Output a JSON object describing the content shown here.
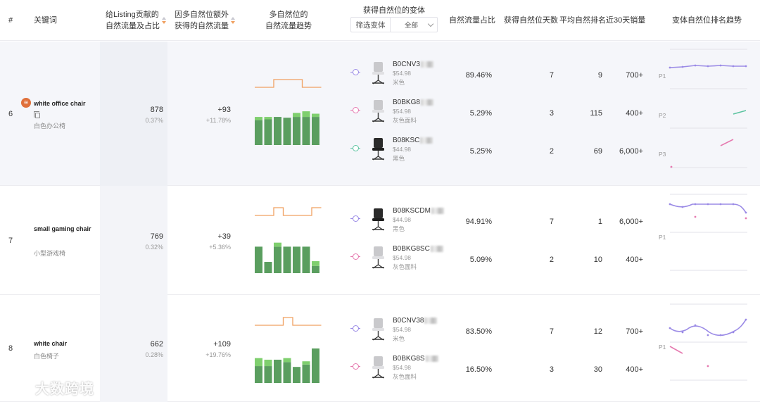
{
  "header": {
    "index": "#",
    "keyword": "关键词",
    "traffic_line1": "给Listing贡献的",
    "traffic_line2": "自然流量及占比",
    "extra_line1": "因多自然位额外",
    "extra_line2": "获得的自然流量",
    "trend_line1": "多自然位的",
    "trend_line2": "自然流量趋势",
    "variants": "获得自然位的变体",
    "filter_label": "筛选变体",
    "filter_value": "全部",
    "share": "自然流量占比",
    "days": "获得自然位天数",
    "avg_rank": "平均自然排名",
    "sales30": "近30天销量",
    "rank_trend": "变体自然位排名趋势"
  },
  "colors": {
    "bar_dark": "#5a9e5f",
    "bar_light": "#7fcf6e",
    "step_line": "#f0a060",
    "purple": "#9b8be6",
    "pink": "#e67ab0",
    "teal": "#5cc4a0"
  },
  "rows": [
    {
      "index": "6",
      "keyword": "white office chair",
      "keyword_cn": "白色办公椅",
      "traffic": "878",
      "traffic_pct": "0.37%",
      "extra": "+93",
      "extra_pct": "+11.78%",
      "bars": [
        [
          0.62,
          0.08
        ],
        [
          0.64,
          0.06
        ],
        [
          0.7,
          0
        ],
        [
          0.68,
          0
        ],
        [
          0.7,
          0.1
        ],
        [
          0.7,
          0.14
        ],
        [
          0.7,
          0.08
        ]
      ],
      "step": [
        0,
        0,
        1,
        1,
        1,
        0,
        0
      ],
      "variants": [
        {
          "asin": "B0CNV3",
          "price": "$54.98",
          "color": "米色",
          "dot": "#9b8be6",
          "chair": "grey",
          "share": "89.46%",
          "days": "7",
          "rank": "9",
          "sales": "700+"
        },
        {
          "asin": "B0BKG8",
          "price": "$54.98",
          "color": "灰色面料",
          "dot": "#e67ab0",
          "chair": "grey",
          "share": "5.29%",
          "days": "3",
          "rank": "115",
          "sales": "400+"
        },
        {
          "asin": "B08KSC",
          "price": "$44.98",
          "color": "黑色",
          "dot": "#5cc4a0",
          "chair": "black",
          "share": "5.25%",
          "days": "2",
          "rank": "69",
          "sales": "6,000+"
        }
      ],
      "p_labels": [
        "P1",
        "P2",
        "P3"
      ]
    },
    {
      "index": "7",
      "keyword": "small gaming chair",
      "keyword_cn": "小型游戏椅",
      "traffic": "769",
      "traffic_pct": "0.32%",
      "extra": "+39",
      "extra_pct": "+5.36%",
      "bars": [
        [
          0.66,
          0
        ],
        [
          0.28,
          0
        ],
        [
          0.66,
          0.1
        ],
        [
          0.66,
          0
        ],
        [
          0.66,
          0
        ],
        [
          0.66,
          0
        ],
        [
          0.18,
          0.12
        ]
      ],
      "step": [
        0,
        0,
        1,
        0,
        0,
        0,
        1
      ],
      "variants": [
        {
          "asin": "B08KSCDM",
          "price": "$44.98",
          "color": "黑色",
          "dot": "#9b8be6",
          "chair": "black",
          "share": "94.91%",
          "days": "7",
          "rank": "1",
          "sales": "6,000+"
        },
        {
          "asin": "B0BKG8SC",
          "price": "$54.98",
          "color": "灰色面料",
          "dot": "#e67ab0",
          "chair": "grey",
          "share": "5.09%",
          "days": "2",
          "rank": "10",
          "sales": "400+"
        }
      ],
      "p_labels": [
        "P1"
      ]
    },
    {
      "index": "8",
      "keyword": "white chair",
      "keyword_cn": "白色椅子",
      "traffic": "662",
      "traffic_pct": "0.28%",
      "extra": "+109",
      "extra_pct": "+19.76%",
      "bars": [
        [
          0.42,
          0.2
        ],
        [
          0.42,
          0.16
        ],
        [
          0.58,
          0
        ],
        [
          0.52,
          0.1
        ],
        [
          0.4,
          0
        ],
        [
          0.46,
          0.08
        ],
        [
          0.86,
          0
        ]
      ],
      "step": [
        0,
        0,
        0,
        1,
        0,
        0,
        0
      ],
      "variants": [
        {
          "asin": "B0CNV38",
          "price": "$54.98",
          "color": "米色",
          "dot": "#9b8be6",
          "chair": "grey",
          "share": "83.50%",
          "days": "7",
          "rank": "12",
          "sales": "700+"
        },
        {
          "asin": "B0BKG8S",
          "price": "$54.98",
          "color": "灰色面料",
          "dot": "#e67ab0",
          "chair": "grey",
          "share": "16.50%",
          "days": "3",
          "rank": "30",
          "sales": "400+"
        }
      ],
      "p_labels": [
        "P1"
      ]
    }
  ],
  "watermark": {
    "text": "大数跨境"
  }
}
